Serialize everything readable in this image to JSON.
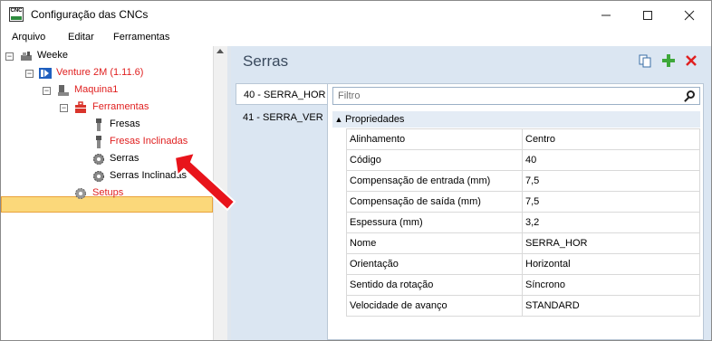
{
  "app": {
    "icon_text": "CNC",
    "title": "Configuração das CNCs",
    "window_controls": [
      "minimize-icon",
      "maximize-icon",
      "close-icon"
    ]
  },
  "menu": [
    {
      "label": "Arquivo"
    },
    {
      "label": "Editar"
    },
    {
      "label": "Ferramentas"
    }
  ],
  "tree": {
    "root": "Weeke",
    "venture": "Venture 2M (1.11.6)",
    "machine": "Maquina1",
    "tools": "Ferramentas",
    "tool_items": [
      "Fresas",
      "Fresas Inclinadas",
      "Serras",
      "Serras Inclinadas"
    ],
    "setups": "Setups",
    "selected": "Serras",
    "colors": {
      "red": "#e02020",
      "selected_bg": "#fbd87a"
    }
  },
  "panel": {
    "title": "Serras",
    "toolbar_icons": [
      "copy-icon",
      "add-icon",
      "delete-icon"
    ],
    "tabs": [
      "40 - SERRA_HOR",
      "41 - SERRA_VER"
    ],
    "active_tab": "40 - SERRA_HOR",
    "filter_placeholder": "Filtro",
    "category": "Propriedades",
    "properties": [
      {
        "name": "Alinhamento",
        "value": "Centro"
      },
      {
        "name": "Código",
        "value": "40"
      },
      {
        "name": "Compensação de entrada (mm)",
        "value": "7,5"
      },
      {
        "name": "Compensação de saída (mm)",
        "value": "7,5"
      },
      {
        "name": "Espessura (mm)",
        "value": "3,2"
      },
      {
        "name": "Nome",
        "value": "SERRA_HOR"
      },
      {
        "name": "Orientação",
        "value": "Horizontal"
      },
      {
        "name": "Sentido da rotação",
        "value": "Síncrono"
      },
      {
        "name": "Velocidade de avanço",
        "value": "STANDARD"
      }
    ]
  },
  "annotation": {
    "arrow_color": "#e8141b"
  }
}
